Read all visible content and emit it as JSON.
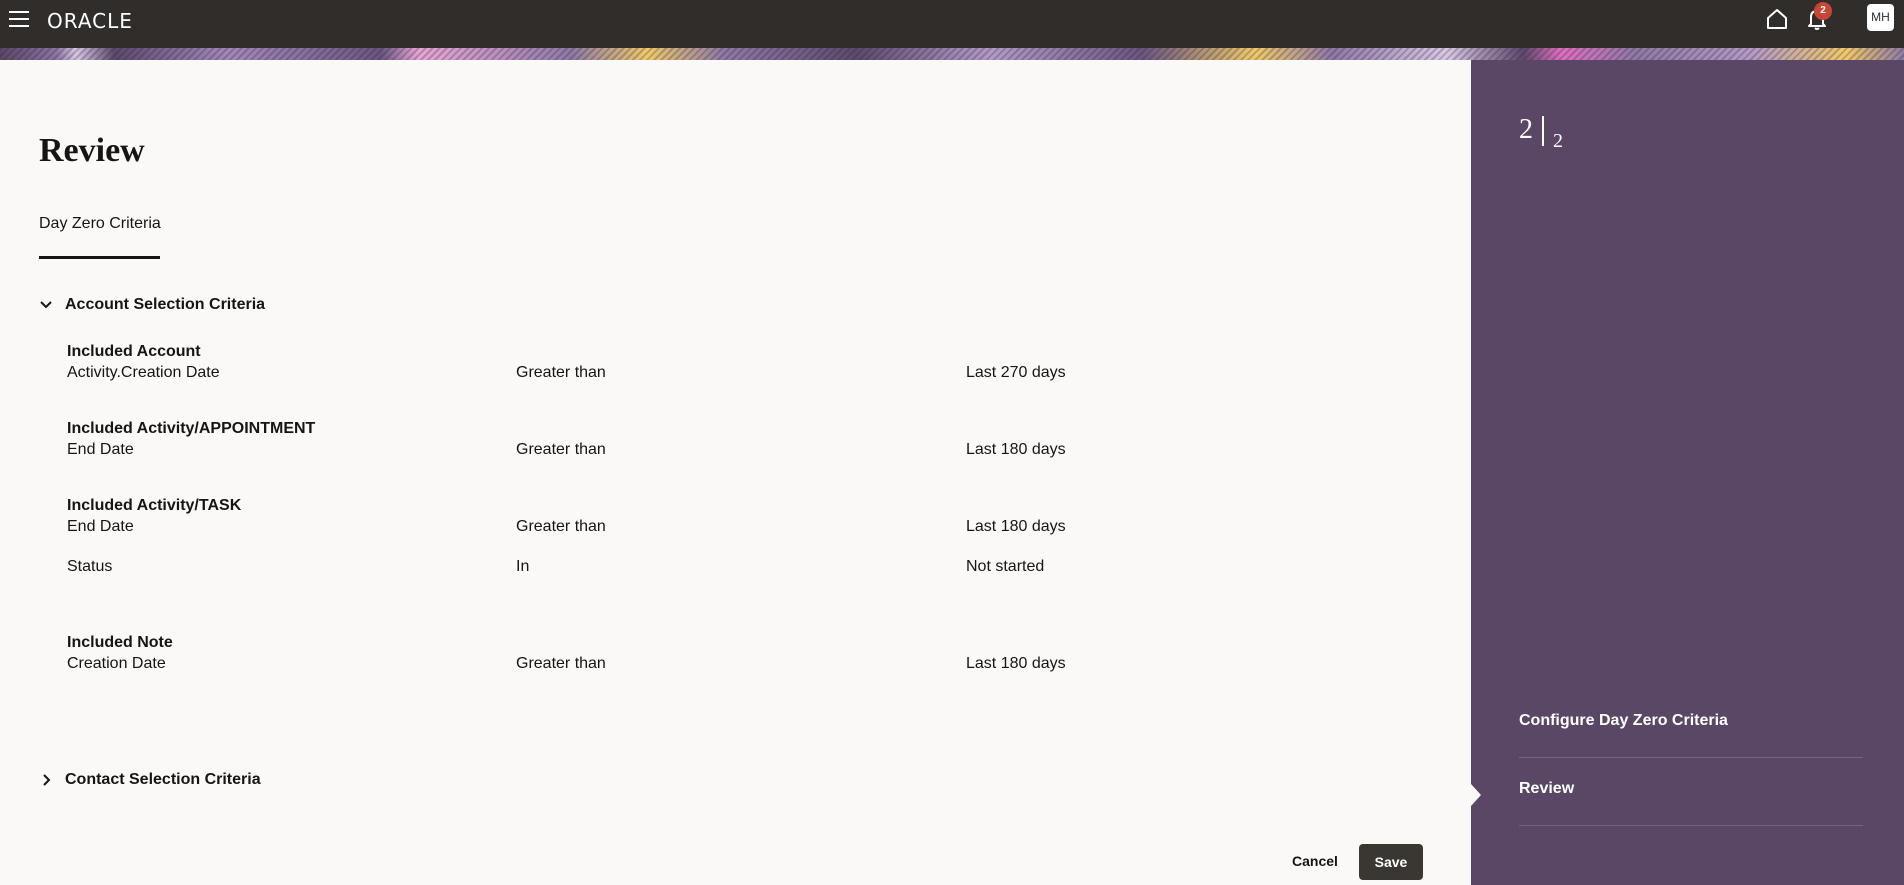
{
  "header": {
    "logo": "ORACLE",
    "menu_icon": "hamburger-icon",
    "home_icon": "home-icon",
    "notifications_icon": "bell-icon",
    "notification_count": "2",
    "user_initials": "MH"
  },
  "page": {
    "title": "Review",
    "tabs": [
      {
        "label": "Day Zero Criteria",
        "selected": true
      }
    ]
  },
  "sections": [
    {
      "title": "Account Selection Criteria",
      "expanded": true,
      "groups": [
        {
          "title": "Included Account",
          "rows": [
            {
              "field": "Activity.Creation Date",
              "operator": "Greater than",
              "value": "Last 270 days"
            }
          ]
        },
        {
          "title": "Included Activity/APPOINTMENT",
          "rows": [
            {
              "field": "End Date",
              "operator": "Greater than",
              "value": "Last 180 days"
            }
          ]
        },
        {
          "title": "Included Activity/TASK",
          "rows": [
            {
              "field": "End Date",
              "operator": "Greater than",
              "value": "Last 180 days"
            },
            {
              "field": "Status",
              "operator": "In",
              "value": "Not started"
            }
          ]
        },
        {
          "title": "Included Note",
          "rows": [
            {
              "field": "Creation Date",
              "operator": "Greater than",
              "value": "Last 180 days"
            }
          ]
        }
      ]
    },
    {
      "title": "Contact Selection Criteria",
      "expanded": false
    }
  ],
  "footer": {
    "cancel_label": "Cancel",
    "save_label": "Save"
  },
  "train": {
    "current_step": "2",
    "total_steps": "2",
    "steps": [
      {
        "label": "Configure Day Zero Criteria"
      },
      {
        "label": "Review",
        "current": true
      }
    ]
  },
  "colors": {
    "header_bg": "#312d2a",
    "side_panel_bg": "#5a4665",
    "badge": "#c74634",
    "primary_button": "#3a3631"
  }
}
